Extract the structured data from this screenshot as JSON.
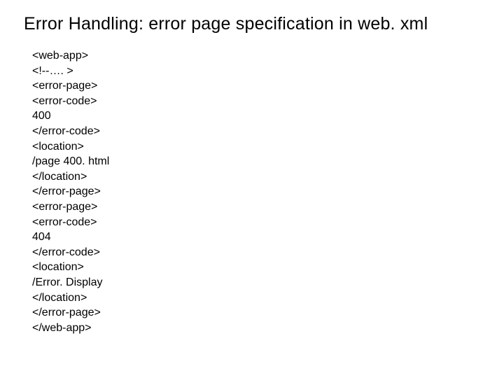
{
  "title": "Error Handling: error page specification in web. xml",
  "code": {
    "line0": "<web-app>",
    "line1": "<!--…. >",
    "line2": "<error-page>",
    "line3": "<error-code>",
    "line4": "400",
    "line5": "</error-code>",
    "line6": "<location>",
    "line7": "/page 400. html",
    "line8": "</location>",
    "line9": "</error-page>",
    "line10": "<error-page>",
    "line11": "<error-code>",
    "line12": "404",
    "line13": "</error-code>",
    "line14": "<location>",
    "line15": "/Error. Display",
    "line16": "</location>",
    "line17": "</error-page>",
    "line18": "</web-app>"
  }
}
